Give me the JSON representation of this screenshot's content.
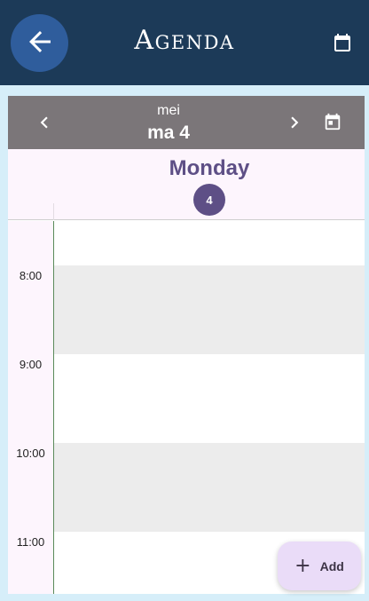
{
  "app_bar": {
    "title": "Agenda",
    "back_icon": "arrow-left-icon",
    "calendar_icon": "calendar-icon",
    "colors": {
      "background": "#1c3a58",
      "back_button": "#2f5d9c"
    }
  },
  "calendar": {
    "nav": {
      "month": "mei",
      "date": "ma 4",
      "prev_icon": "chevron-left-icon",
      "next_icon": "chevron-right-icon",
      "today_icon": "calendar-today-icon"
    },
    "day_header": {
      "day_name": "Monday",
      "day_number": "4",
      "accent": "#5e4f86"
    },
    "time_labels": [
      "8:00",
      "9:00",
      "10:00",
      "11:00"
    ]
  },
  "fab": {
    "icon": "plus-icon",
    "label": "Add"
  }
}
